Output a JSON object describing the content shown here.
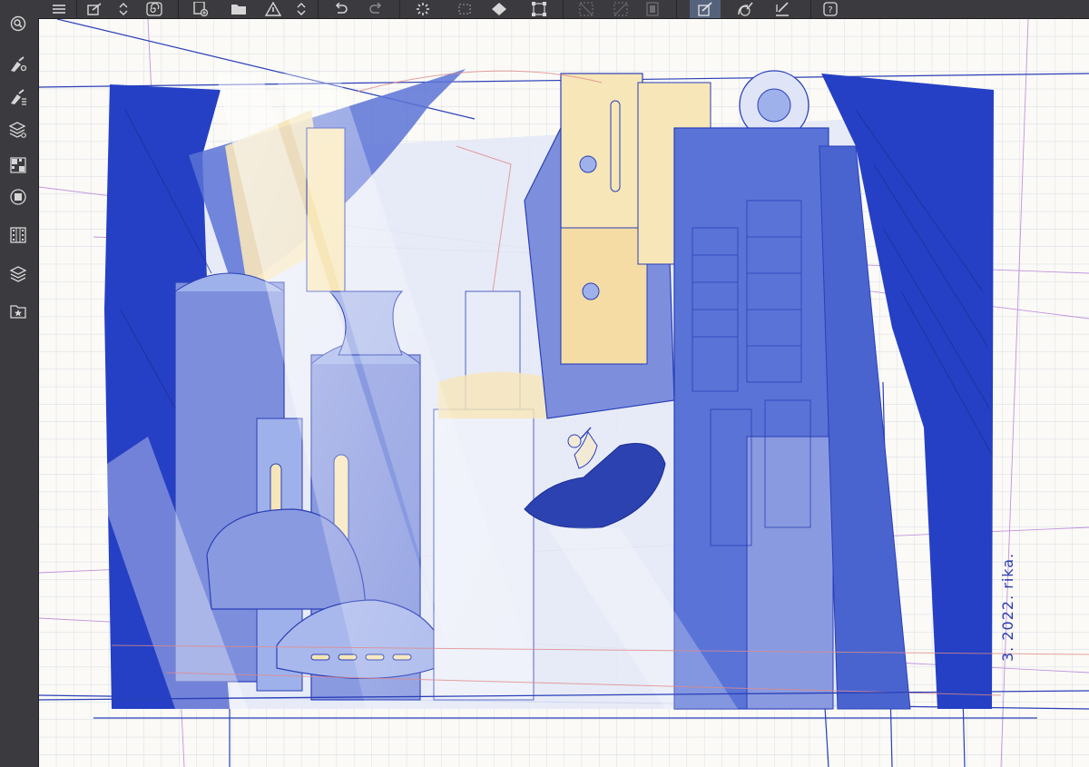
{
  "app": {
    "accent_color": "#55627c",
    "chrome_color": "#3b3b3f",
    "icon_color": "#d6d6d6"
  },
  "toolbar": {
    "items": [
      {
        "icon": "hamburger-menu-icon"
      },
      {
        "icon": "edit-icon"
      },
      {
        "icon": "chevron-updown-icon"
      },
      {
        "icon": "spiral-icon"
      },
      {
        "icon": "new-canvas-icon"
      },
      {
        "icon": "open-folder-icon"
      },
      {
        "icon": "save-icon"
      },
      {
        "icon": "chevron-updown-icon"
      },
      {
        "icon": "undo-icon"
      },
      {
        "icon": "redo-icon"
      },
      {
        "icon": "loading-icon"
      },
      {
        "icon": "selection-icon"
      },
      {
        "icon": "fill-icon"
      },
      {
        "icon": "transform-icon"
      },
      {
        "icon": "clear-icon"
      },
      {
        "icon": "crop-icon"
      },
      {
        "icon": "layer-icon"
      },
      {
        "icon": "snap-ruler-icon",
        "active": true
      },
      {
        "icon": "snap-curve-icon"
      },
      {
        "icon": "snap-grid-icon"
      },
      {
        "icon": "help-icon"
      }
    ]
  },
  "sidebar": {
    "items": [
      {
        "icon": "navigator-icon"
      },
      {
        "icon": "brush-tool-icon"
      },
      {
        "icon": "brush-settings-icon"
      },
      {
        "icon": "sub-tool-icon"
      },
      {
        "icon": "color-palette-icon"
      },
      {
        "icon": "color-circle-icon"
      },
      {
        "icon": "timeline-icon"
      },
      {
        "icon": "layers-icon"
      },
      {
        "icon": "materials-icon"
      }
    ]
  },
  "artwork": {
    "signature": "3. 2022. rika.",
    "colors": {
      "ink": "#2a3fb8",
      "dark_blue": "#2540c4",
      "mid_blue": "#5a73d6",
      "light_blue": "#9fb1ea",
      "haze": "#cdd6f2",
      "cream": "#f7e6b8",
      "grid": "#b9c3d9",
      "red_sketch": "#e08a8a",
      "purple_guide": "#b07ad8"
    }
  }
}
